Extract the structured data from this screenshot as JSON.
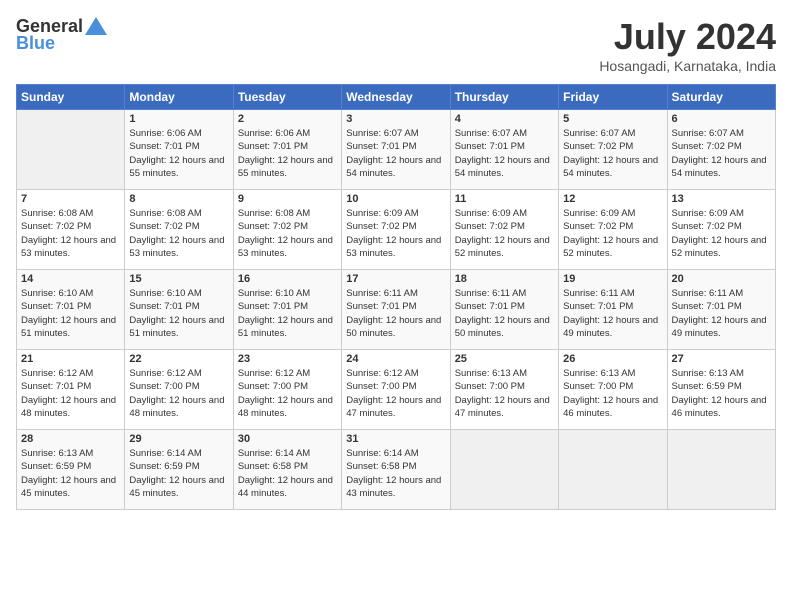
{
  "header": {
    "logo_general": "General",
    "logo_blue": "Blue",
    "month_title": "July 2024",
    "location": "Hosangadi, Karnataka, India"
  },
  "days_of_week": [
    "Sunday",
    "Monday",
    "Tuesday",
    "Wednesday",
    "Thursday",
    "Friday",
    "Saturday"
  ],
  "weeks": [
    [
      {
        "day": "",
        "sunrise": "",
        "sunset": "",
        "daylight": ""
      },
      {
        "day": "1",
        "sunrise": "Sunrise: 6:06 AM",
        "sunset": "Sunset: 7:01 PM",
        "daylight": "Daylight: 12 hours and 55 minutes."
      },
      {
        "day": "2",
        "sunrise": "Sunrise: 6:06 AM",
        "sunset": "Sunset: 7:01 PM",
        "daylight": "Daylight: 12 hours and 55 minutes."
      },
      {
        "day": "3",
        "sunrise": "Sunrise: 6:07 AM",
        "sunset": "Sunset: 7:01 PM",
        "daylight": "Daylight: 12 hours and 54 minutes."
      },
      {
        "day": "4",
        "sunrise": "Sunrise: 6:07 AM",
        "sunset": "Sunset: 7:01 PM",
        "daylight": "Daylight: 12 hours and 54 minutes."
      },
      {
        "day": "5",
        "sunrise": "Sunrise: 6:07 AM",
        "sunset": "Sunset: 7:02 PM",
        "daylight": "Daylight: 12 hours and 54 minutes."
      },
      {
        "day": "6",
        "sunrise": "Sunrise: 6:07 AM",
        "sunset": "Sunset: 7:02 PM",
        "daylight": "Daylight: 12 hours and 54 minutes."
      }
    ],
    [
      {
        "day": "7",
        "sunrise": "Sunrise: 6:08 AM",
        "sunset": "Sunset: 7:02 PM",
        "daylight": "Daylight: 12 hours and 53 minutes."
      },
      {
        "day": "8",
        "sunrise": "Sunrise: 6:08 AM",
        "sunset": "Sunset: 7:02 PM",
        "daylight": "Daylight: 12 hours and 53 minutes."
      },
      {
        "day": "9",
        "sunrise": "Sunrise: 6:08 AM",
        "sunset": "Sunset: 7:02 PM",
        "daylight": "Daylight: 12 hours and 53 minutes."
      },
      {
        "day": "10",
        "sunrise": "Sunrise: 6:09 AM",
        "sunset": "Sunset: 7:02 PM",
        "daylight": "Daylight: 12 hours and 53 minutes."
      },
      {
        "day": "11",
        "sunrise": "Sunrise: 6:09 AM",
        "sunset": "Sunset: 7:02 PM",
        "daylight": "Daylight: 12 hours and 52 minutes."
      },
      {
        "day": "12",
        "sunrise": "Sunrise: 6:09 AM",
        "sunset": "Sunset: 7:02 PM",
        "daylight": "Daylight: 12 hours and 52 minutes."
      },
      {
        "day": "13",
        "sunrise": "Sunrise: 6:09 AM",
        "sunset": "Sunset: 7:02 PM",
        "daylight": "Daylight: 12 hours and 52 minutes."
      }
    ],
    [
      {
        "day": "14",
        "sunrise": "Sunrise: 6:10 AM",
        "sunset": "Sunset: 7:01 PM",
        "daylight": "Daylight: 12 hours and 51 minutes."
      },
      {
        "day": "15",
        "sunrise": "Sunrise: 6:10 AM",
        "sunset": "Sunset: 7:01 PM",
        "daylight": "Daylight: 12 hours and 51 minutes."
      },
      {
        "day": "16",
        "sunrise": "Sunrise: 6:10 AM",
        "sunset": "Sunset: 7:01 PM",
        "daylight": "Daylight: 12 hours and 51 minutes."
      },
      {
        "day": "17",
        "sunrise": "Sunrise: 6:11 AM",
        "sunset": "Sunset: 7:01 PM",
        "daylight": "Daylight: 12 hours and 50 minutes."
      },
      {
        "day": "18",
        "sunrise": "Sunrise: 6:11 AM",
        "sunset": "Sunset: 7:01 PM",
        "daylight": "Daylight: 12 hours and 50 minutes."
      },
      {
        "day": "19",
        "sunrise": "Sunrise: 6:11 AM",
        "sunset": "Sunset: 7:01 PM",
        "daylight": "Daylight: 12 hours and 49 minutes."
      },
      {
        "day": "20",
        "sunrise": "Sunrise: 6:11 AM",
        "sunset": "Sunset: 7:01 PM",
        "daylight": "Daylight: 12 hours and 49 minutes."
      }
    ],
    [
      {
        "day": "21",
        "sunrise": "Sunrise: 6:12 AM",
        "sunset": "Sunset: 7:01 PM",
        "daylight": "Daylight: 12 hours and 48 minutes."
      },
      {
        "day": "22",
        "sunrise": "Sunrise: 6:12 AM",
        "sunset": "Sunset: 7:00 PM",
        "daylight": "Daylight: 12 hours and 48 minutes."
      },
      {
        "day": "23",
        "sunrise": "Sunrise: 6:12 AM",
        "sunset": "Sunset: 7:00 PM",
        "daylight": "Daylight: 12 hours and 48 minutes."
      },
      {
        "day": "24",
        "sunrise": "Sunrise: 6:12 AM",
        "sunset": "Sunset: 7:00 PM",
        "daylight": "Daylight: 12 hours and 47 minutes."
      },
      {
        "day": "25",
        "sunrise": "Sunrise: 6:13 AM",
        "sunset": "Sunset: 7:00 PM",
        "daylight": "Daylight: 12 hours and 47 minutes."
      },
      {
        "day": "26",
        "sunrise": "Sunrise: 6:13 AM",
        "sunset": "Sunset: 7:00 PM",
        "daylight": "Daylight: 12 hours and 46 minutes."
      },
      {
        "day": "27",
        "sunrise": "Sunrise: 6:13 AM",
        "sunset": "Sunset: 6:59 PM",
        "daylight": "Daylight: 12 hours and 46 minutes."
      }
    ],
    [
      {
        "day": "28",
        "sunrise": "Sunrise: 6:13 AM",
        "sunset": "Sunset: 6:59 PM",
        "daylight": "Daylight: 12 hours and 45 minutes."
      },
      {
        "day": "29",
        "sunrise": "Sunrise: 6:14 AM",
        "sunset": "Sunset: 6:59 PM",
        "daylight": "Daylight: 12 hours and 45 minutes."
      },
      {
        "day": "30",
        "sunrise": "Sunrise: 6:14 AM",
        "sunset": "Sunset: 6:58 PM",
        "daylight": "Daylight: 12 hours and 44 minutes."
      },
      {
        "day": "31",
        "sunrise": "Sunrise: 6:14 AM",
        "sunset": "Sunset: 6:58 PM",
        "daylight": "Daylight: 12 hours and 43 minutes."
      },
      {
        "day": "",
        "sunrise": "",
        "sunset": "",
        "daylight": ""
      },
      {
        "day": "",
        "sunrise": "",
        "sunset": "",
        "daylight": ""
      },
      {
        "day": "",
        "sunrise": "",
        "sunset": "",
        "daylight": ""
      }
    ]
  ]
}
